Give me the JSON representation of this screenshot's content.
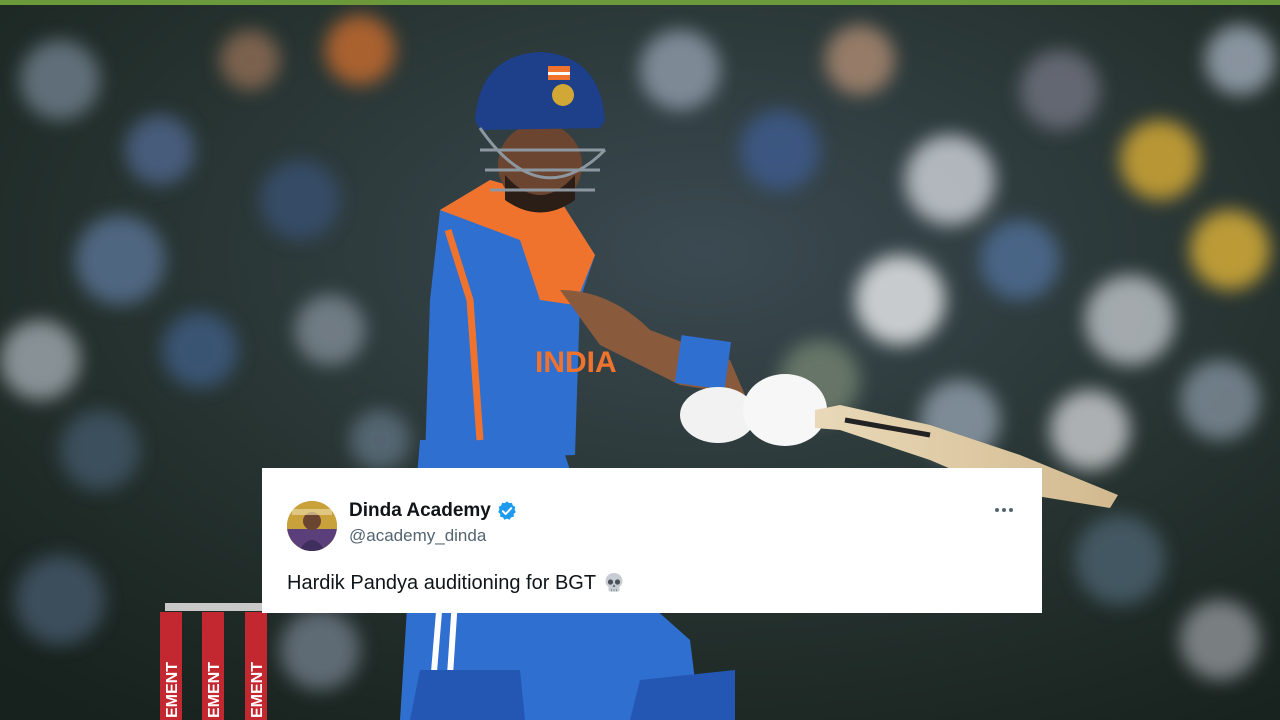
{
  "background": {
    "jersey_text": "INDIA",
    "stump_text": "EMENT"
  },
  "tweet": {
    "display_name": "Dinda Academy",
    "handle": "@academy_dinda",
    "text": "Hardik Pandya auditioning for BGT",
    "verified_icon": "verified-badge-icon",
    "more_icon": "more-options-icon",
    "emoji_icon": "skull-icon"
  },
  "colors": {
    "verified_blue": "#1d9bf0",
    "jersey_blue": "#2f6fd0",
    "jersey_orange": "#f0732d",
    "stump_red": "#c3272f",
    "top_bar": "#6a9a3c"
  }
}
